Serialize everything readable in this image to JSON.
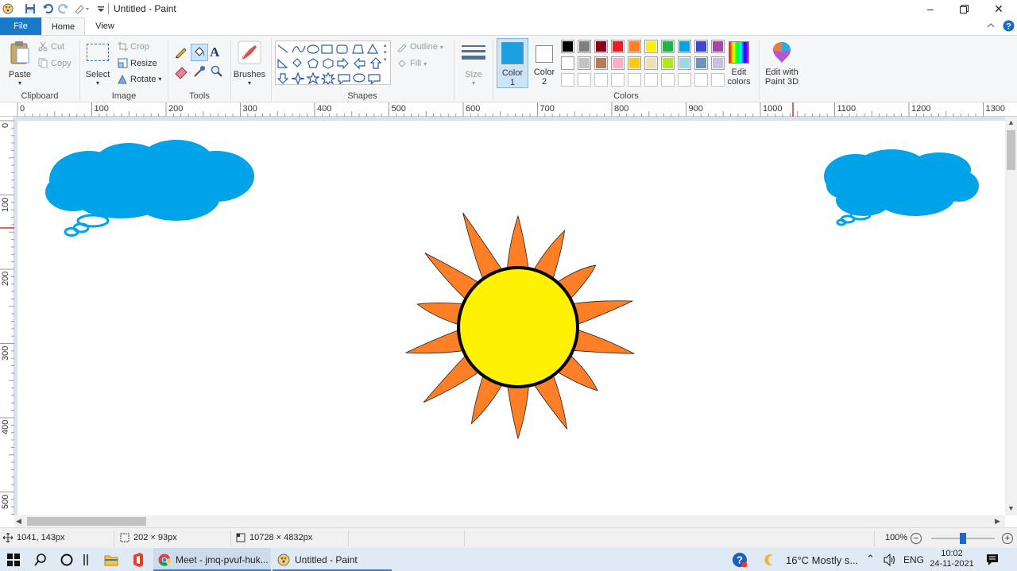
{
  "window": {
    "title": "Untitled - Paint",
    "minimize": "–",
    "restore": "❐",
    "close": "✕"
  },
  "tabs": {
    "file": "File",
    "home": "Home",
    "view": "View"
  },
  "ribbon": {
    "clipboard": {
      "label": "Clipboard",
      "paste": "Paste",
      "cut": "Cut",
      "copy": "Copy"
    },
    "image": {
      "label": "Image",
      "select": "Select",
      "crop": "Crop",
      "resize": "Resize",
      "rotate": "Rotate"
    },
    "tools": {
      "label": "Tools"
    },
    "brushes": {
      "label": "Brushes"
    },
    "shapes": {
      "label": "Shapes",
      "outline": "Outline",
      "fill": "Fill"
    },
    "size": {
      "label": "Size"
    },
    "colors": {
      "label": "Colors",
      "color1": "Color\n1",
      "color1_l1": "Color",
      "color1_l2": "1",
      "color2_l1": "Color",
      "color2_l2": "2",
      "edit_l1": "Edit",
      "edit_l2": "colors",
      "color1_value": "#1ba1e2",
      "color2_value": "#ffffff",
      "palette_row1": [
        "#000000",
        "#7f7f7f",
        "#880015",
        "#ed1c24",
        "#ff7f27",
        "#fff200",
        "#22b14c",
        "#00a2e8",
        "#3f48cc",
        "#a349a4"
      ],
      "palette_row2": [
        "#ffffff",
        "#c3c3c3",
        "#b97a57",
        "#ffaec9",
        "#ffc90e",
        "#efe4b0",
        "#b5e61d",
        "#99d9ea",
        "#7092be",
        "#c8bfe7"
      ]
    },
    "paint3d": {
      "l1": "Edit with",
      "l2": "Paint 3D"
    }
  },
  "ruler": {
    "h": [
      "0",
      "100",
      "200",
      "300",
      "400",
      "500",
      "600",
      "700",
      "800",
      "900",
      "1000",
      "1100",
      "1200",
      "1300"
    ],
    "v": [
      "0",
      "100",
      "200",
      "300",
      "400",
      "500"
    ]
  },
  "status": {
    "cursor": "1041, 143px",
    "selection": "202 × 93px",
    "image_size": "10728 × 4832px",
    "zoom": "100%",
    "zoom_fraction": 0.5
  },
  "taskbar": {
    "app1": "Meet - jmq-pvuf-huk...",
    "app2": "Untitled - Paint",
    "weather": "16°C  Mostly s...",
    "lang": "ENG",
    "time": "10:02",
    "date": "24-11-2021"
  }
}
